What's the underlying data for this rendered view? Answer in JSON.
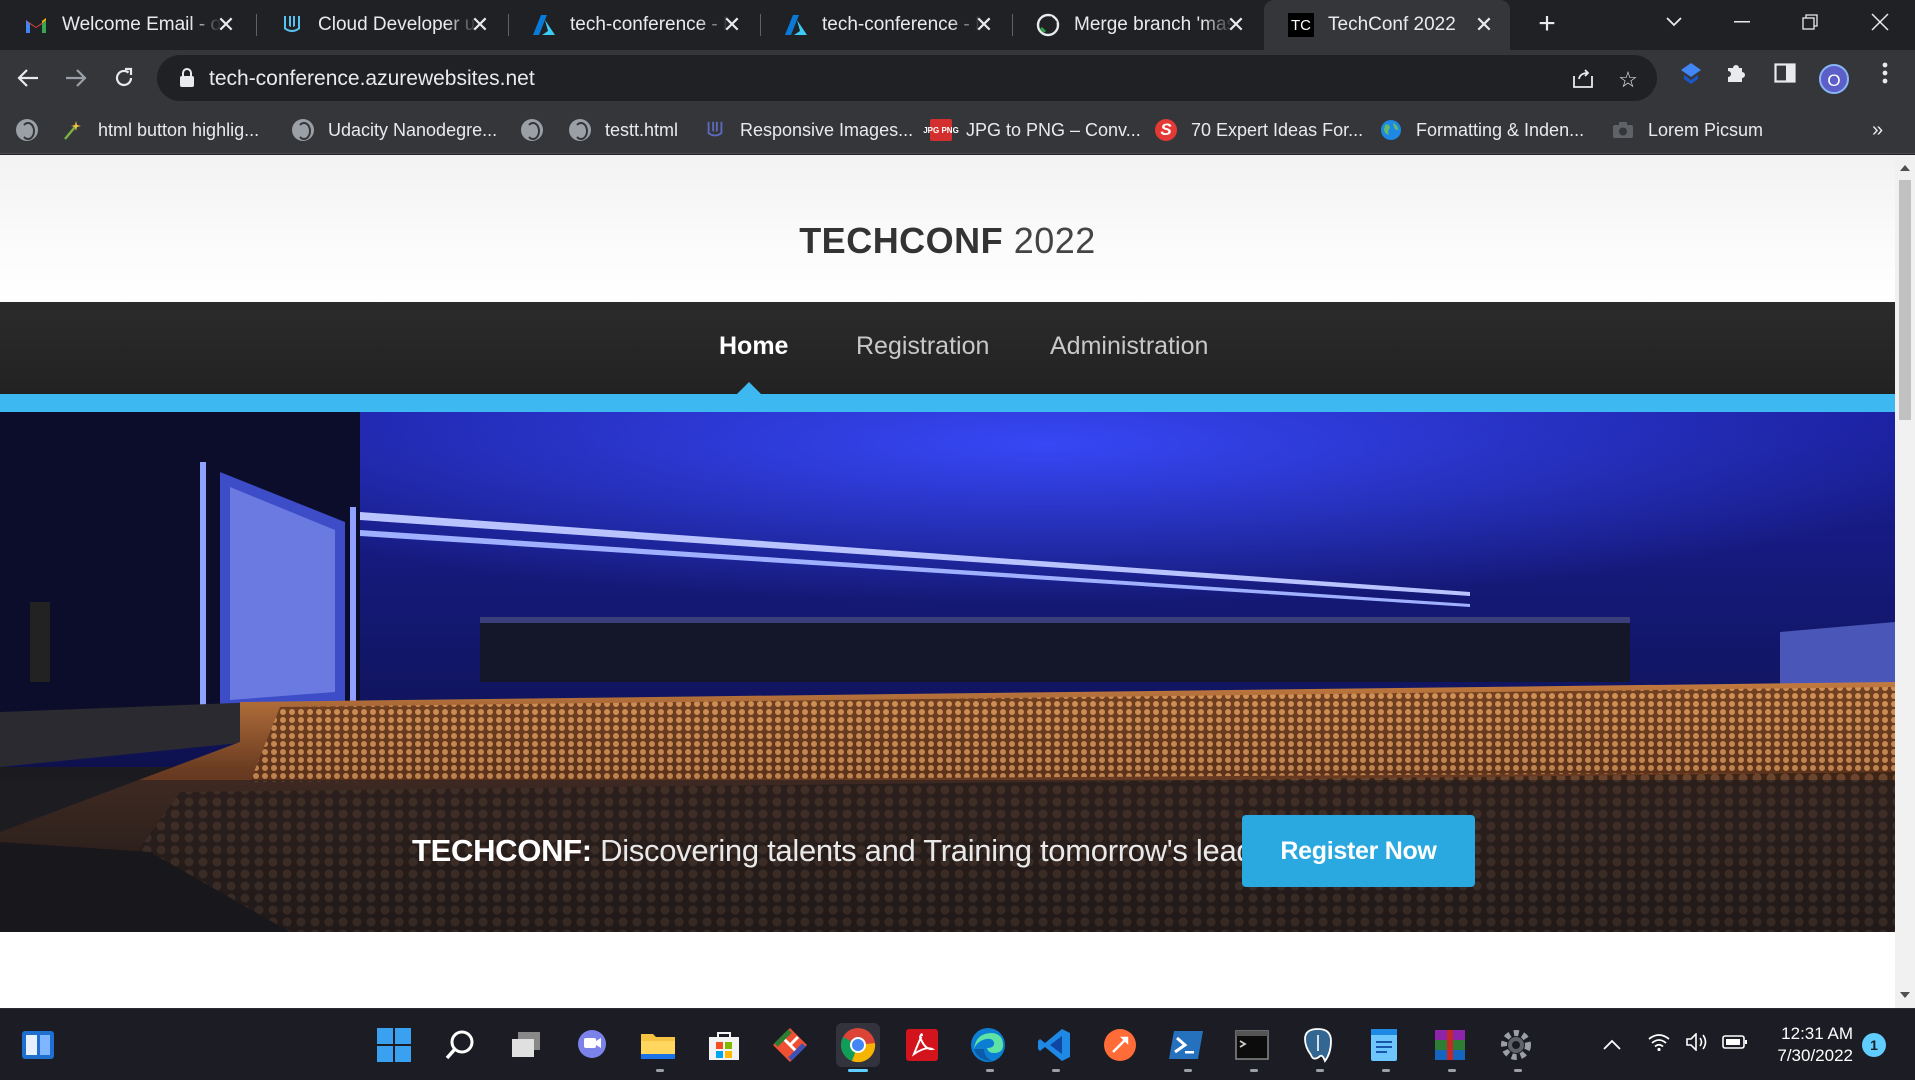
{
  "browser": {
    "tabs": [
      {
        "title": "Welcome Email - oyenireoluwatobi@gmail.com",
        "icon": "gmail-icon"
      },
      {
        "title": "Cloud Developer using Microsoft Azure",
        "icon": "udacity-icon"
      },
      {
        "title": "tech-conference - Microsoft Azure",
        "icon": "azure-icon"
      },
      {
        "title": "tech-conference - Microsoft Azure",
        "icon": "azure-icon"
      },
      {
        "title": "Merge branch 'master'",
        "icon": "github-icon"
      },
      {
        "title": "TechConf 2022",
        "icon": "techconf-favicon",
        "favicon_text": "TC",
        "active": true
      }
    ],
    "url": "tech-conference.azurewebsites.net",
    "profile_initial": "O",
    "bookmarks": [
      {
        "label": "",
        "icon": "globe-icon"
      },
      {
        "label": "html button highlig...",
        "icon": "bookmark-star-icon"
      },
      {
        "label": "Udacity Nanodegre...",
        "icon": "globe-icon"
      },
      {
        "label": "",
        "icon": "globe-icon"
      },
      {
        "label": "testt.html",
        "icon": "globe-icon"
      },
      {
        "label": "Responsive Images...",
        "icon": "udacity-icon"
      },
      {
        "label": "JPG to PNG – Conv...",
        "icon": "jpg-png-icon",
        "icon_text": "JPG PNG"
      },
      {
        "label": "70 Expert Ideas For...",
        "icon": "s-logo-icon",
        "icon_text": "S"
      },
      {
        "label": "Formatting & Inden...",
        "icon": "earth-icon"
      },
      {
        "label": "Lorem Picsum",
        "icon": "camera-icon"
      }
    ]
  },
  "site": {
    "brand_bold": "TECHCONF",
    "brand_year": "2022",
    "nav": [
      {
        "label": "Home",
        "active": true
      },
      {
        "label": "Registration"
      },
      {
        "label": "Administration"
      }
    ],
    "hero": {
      "tagline_bold": "TECHCONF:",
      "tagline_rest": " Discovering talents and Training tomorrow's leaders",
      "cta_label": "Register Now"
    },
    "accent_color": "#3db8f0",
    "cta_color": "#2aa8e0"
  },
  "taskbar": {
    "apps": [
      "windows-start-icon",
      "search-icon",
      "task-view-icon",
      "teams-chat-icon",
      "file-explorer-icon",
      "microsoft-store-icon",
      "git-icon",
      "chrome-icon",
      "acrobat-icon",
      "edge-icon",
      "vscode-icon",
      "postman-icon",
      "powershell-icon",
      "terminal-icon",
      "postgres-icon",
      "notepad-icon",
      "winrar-icon",
      "settings-icon"
    ],
    "time": "12:31 AM",
    "date": "7/30/2022",
    "notification_count": "1"
  }
}
